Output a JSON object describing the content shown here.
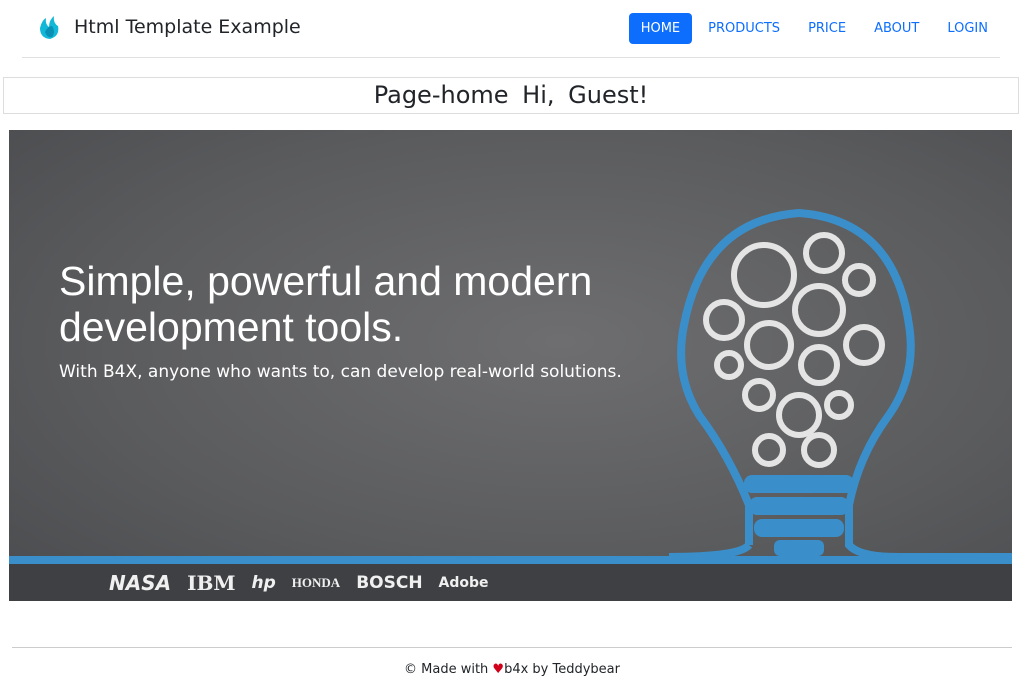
{
  "brand": {
    "title": "Html Template Example",
    "icon": "flame-logo-icon"
  },
  "nav": {
    "items": [
      {
        "label": "HOME",
        "active": true
      },
      {
        "label": "PRODUCTS"
      },
      {
        "label": "PRICE"
      },
      {
        "label": "ABOUT"
      },
      {
        "label": "LOGIN"
      }
    ]
  },
  "page": {
    "title": "Page-home",
    "greeting": "Hi, Guest!"
  },
  "banner": {
    "headline_1": "Simple, powerful and modern",
    "headline_2": "development tools.",
    "subtitle": "With B4X, anyone who wants to, can develop real-world solutions.",
    "logos": [
      "NASA",
      "IBM",
      "hp",
      "HONDA",
      "BOSCH",
      "Adobe"
    ]
  },
  "footer": {
    "prefix": "© Made with",
    "suffix": "b4x by Teddybear"
  },
  "colors": {
    "accent": "#0d6efd",
    "strip": "#3a8fcb"
  }
}
